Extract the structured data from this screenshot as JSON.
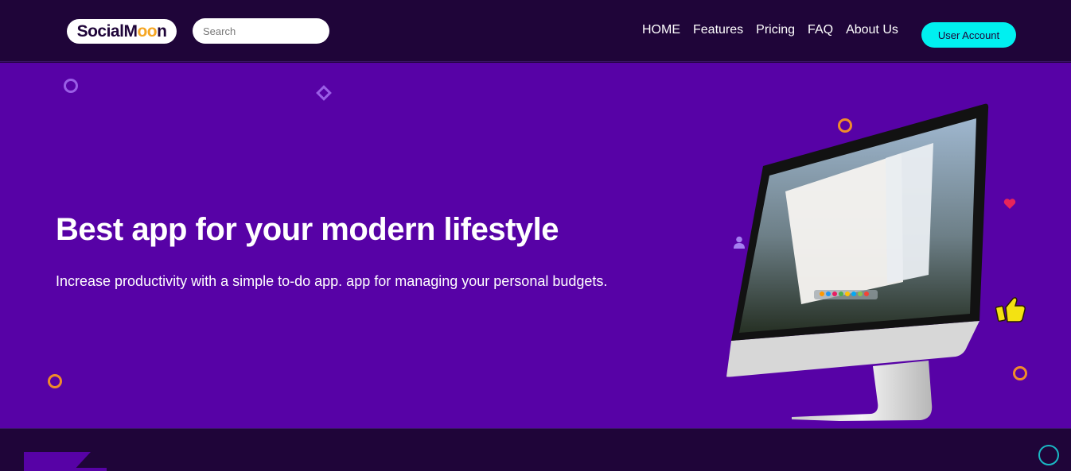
{
  "header": {
    "logo_text_a": "SocialM",
    "logo_text_b": "oo",
    "logo_text_c": "n",
    "search_placeholder": "Search",
    "nav": [
      "HOME",
      "Features",
      "Pricing",
      "FAQ",
      "About Us"
    ],
    "user_button": "User Account"
  },
  "hero": {
    "title": "Best app for your modern lifestyle",
    "subtitle": "Increase productivity with a simple to-do app. app for managing your personal budgets."
  },
  "colors": {
    "header_bg": "#1f0539",
    "hero_bg": "#5702a6",
    "accent_cyan": "#00f0f0",
    "decor_orange": "#f08c2a",
    "decor_lavender": "#9a5ee6",
    "thumbs_yellow": "#f3e212",
    "heart_red": "#e8245a",
    "ring_teal": "#1ab8c4"
  },
  "icons": [
    "ring-icon",
    "diamond-icon",
    "heart-icon",
    "user-icon",
    "thumbs-up-icon",
    "imac-monitor-icon"
  ]
}
